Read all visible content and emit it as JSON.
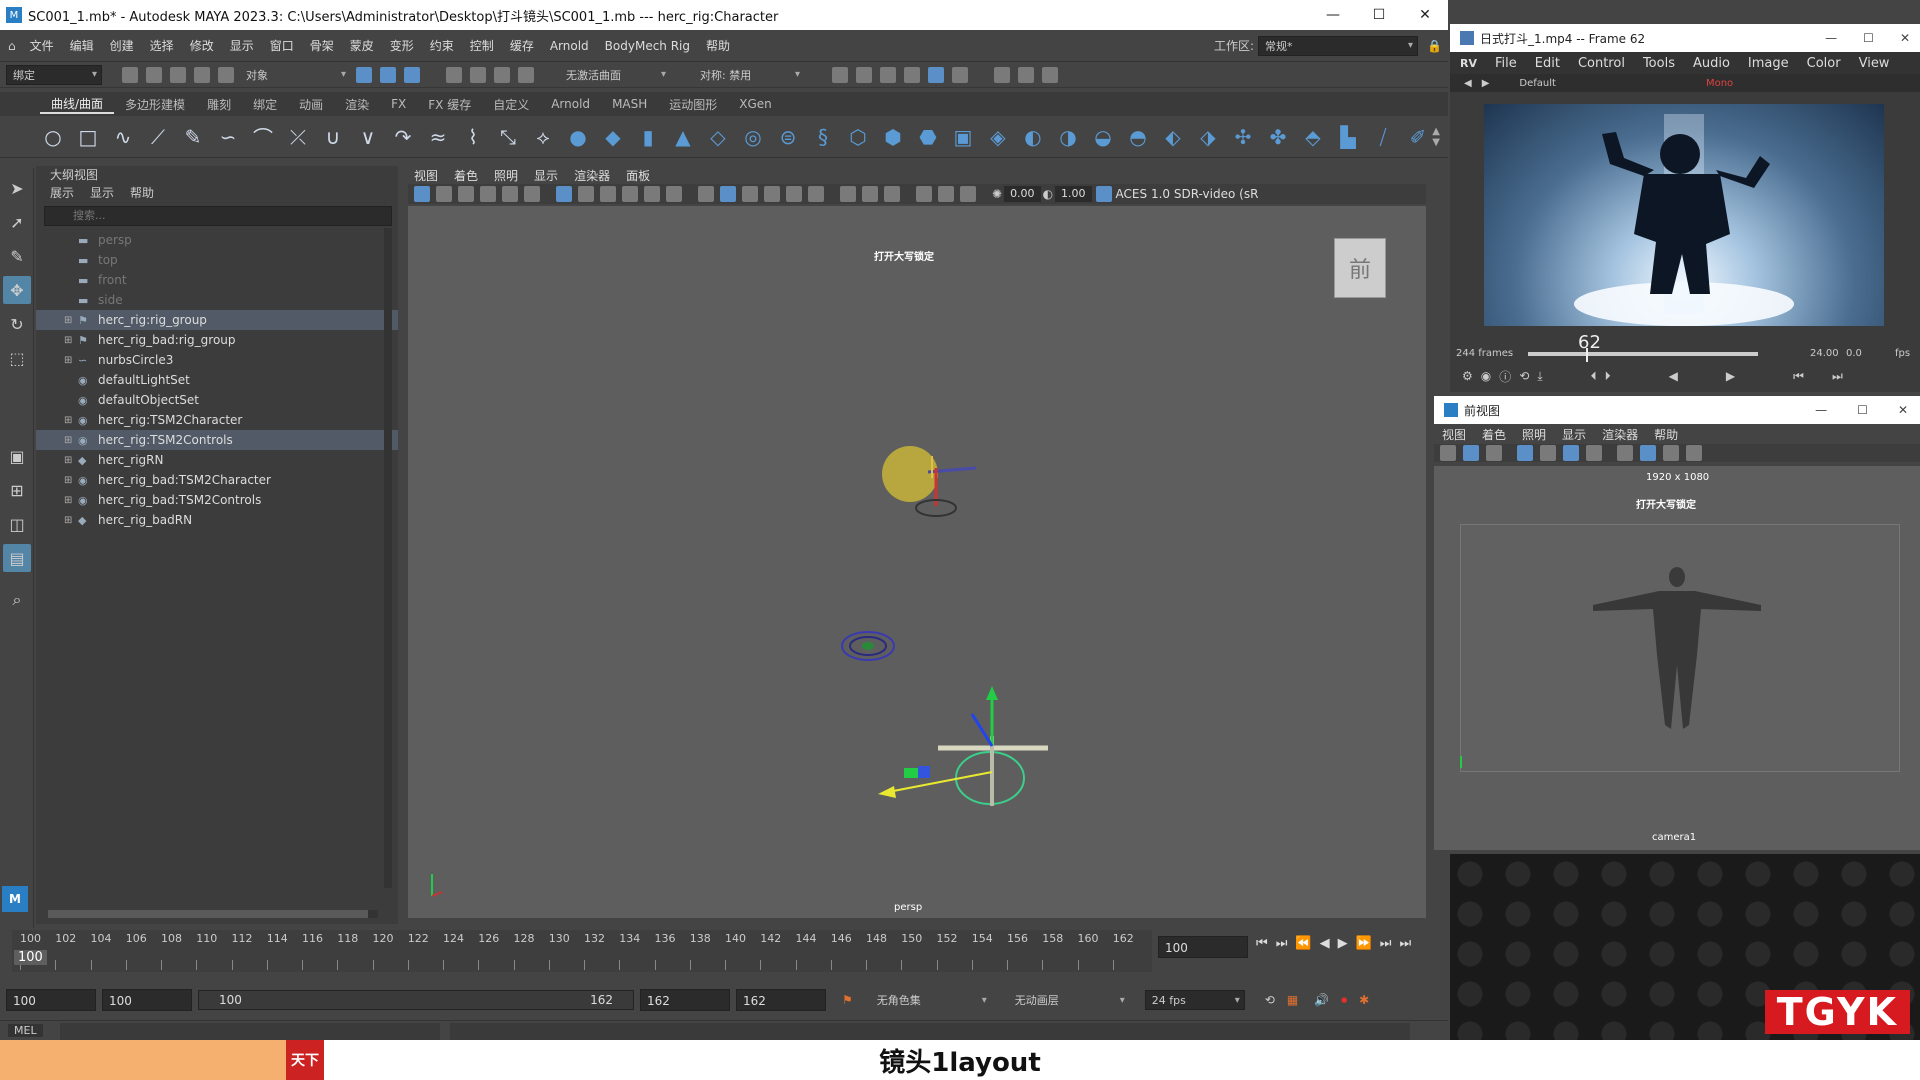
{
  "maya": {
    "title": "SC001_1.mb* - Autodesk MAYA 2023.3: C:\\Users\\Administrator\\Desktop\\打斗镜头\\SC001_1.mb  ---  herc_rig:Character",
    "window_buttons": [
      "—",
      "☐",
      "✕"
    ],
    "menu": [
      "文件",
      "编辑",
      "创建",
      "选择",
      "修改",
      "显示",
      "窗口",
      "骨架",
      "蒙皮",
      "变形",
      "约束",
      "控制",
      "缓存",
      "Arnold",
      "BodyMech Rig",
      "帮助"
    ],
    "workspace_label": "工作区:",
    "workspace_value": "常规*",
    "status": {
      "mode": "绑定",
      "object": "对象",
      "live_surface": "无激活曲面",
      "symmetry": "对称: 禁用"
    },
    "shelf_tabs": [
      "曲线/曲面",
      "多边形建模",
      "雕刻",
      "绑定",
      "动画",
      "渲染",
      "FX",
      "FX 缓存",
      "自定义",
      "Arnold",
      "MASH",
      "运动图形",
      "XGen"
    ],
    "active_shelf_tab": 0
  },
  "outliner": {
    "title": "大纲视图",
    "menu": [
      "展示",
      "显示",
      "帮助"
    ],
    "search_placeholder": "搜索...",
    "items": [
      {
        "label": "persp",
        "icon": "camera-icon",
        "dim": true,
        "expand": ""
      },
      {
        "label": "top",
        "icon": "camera-icon",
        "dim": true,
        "expand": ""
      },
      {
        "label": "front",
        "icon": "camera-icon",
        "dim": true,
        "expand": ""
      },
      {
        "label": "side",
        "icon": "camera-icon",
        "dim": true,
        "expand": ""
      },
      {
        "label": "herc_rig:rig_group",
        "icon": "group-icon",
        "dim": false,
        "expand": "⊞",
        "selected": true
      },
      {
        "label": "herc_rig_bad:rig_group",
        "icon": "group-icon",
        "dim": false,
        "expand": "⊞"
      },
      {
        "label": "nurbsCircle3",
        "icon": "curve-icon",
        "dim": false,
        "expand": "⊞"
      },
      {
        "label": "defaultLightSet",
        "icon": "set-icon",
        "dim": false,
        "expand": ""
      },
      {
        "label": "defaultObjectSet",
        "icon": "set-icon",
        "dim": false,
        "expand": ""
      },
      {
        "label": "herc_rig:TSM2Character",
        "icon": "set-icon",
        "dim": false,
        "expand": "⊞"
      },
      {
        "label": "herc_rig:TSM2Controls",
        "icon": "set-icon",
        "dim": false,
        "expand": "⊞",
        "selected": true
      },
      {
        "label": "herc_rigRN",
        "icon": "reference-icon",
        "dim": false,
        "expand": "⊞"
      },
      {
        "label": "herc_rig_bad:TSM2Character",
        "icon": "set-icon",
        "dim": false,
        "expand": "⊞"
      },
      {
        "label": "herc_rig_bad:TSM2Controls",
        "icon": "set-icon",
        "dim": false,
        "expand": "⊞"
      },
      {
        "label": "herc_rig_badRN",
        "icon": "reference-icon",
        "dim": false,
        "expand": "⊞"
      }
    ]
  },
  "viewport": {
    "menu": [
      "视图",
      "着色",
      "照明",
      "显示",
      "渲染器",
      "面板"
    ],
    "exposure": "0.00",
    "gamma": "1.00",
    "color_space": "ACES 1.0 SDR-video (sR",
    "hud_top": "打开大写锁定",
    "view_cube": "前",
    "camera_label": "persp"
  },
  "timeline": {
    "ticks": [
      "100",
      "102",
      "104",
      "106",
      "108",
      "110",
      "112",
      "114",
      "116",
      "118",
      "120",
      "122",
      "124",
      "126",
      "128",
      "130",
      "132",
      "134",
      "136",
      "138",
      "140",
      "142",
      "144",
      "146",
      "148",
      "150",
      "152",
      "154",
      "156",
      "158",
      "160",
      "162"
    ],
    "current": "100",
    "current_field": "100"
  },
  "range": {
    "start": "100",
    "anim_start": "100",
    "slider_start": "100",
    "slider_end": "162",
    "anim_end": "162",
    "end": "162",
    "character_set": "无角色集",
    "anim_layer": "无动画层",
    "fps": "24 fps",
    "mel": "MEL"
  },
  "rv": {
    "title": "日式打斗_1.mp4 -- Frame 62",
    "menu": [
      "RV",
      "File",
      "Edit",
      "Control",
      "Tools",
      "Audio",
      "Image",
      "Color",
      "View"
    ],
    "bar": [
      "Default",
      "Mono"
    ],
    "frame": "62",
    "frames": "244 frames",
    "fps": "24.00",
    "speed": "0.0",
    "fps_label": "fps"
  },
  "front_view": {
    "title": "前视图",
    "menu": [
      "视图",
      "着色",
      "照明",
      "显示",
      "渲染器",
      "帮助"
    ],
    "resolution": "1920 x 1080",
    "hud_top": "打开大写锁定",
    "camera_label": "camera1"
  },
  "overlay": {
    "subtitle": "镜头1layout",
    "logo": "TGYK"
  }
}
